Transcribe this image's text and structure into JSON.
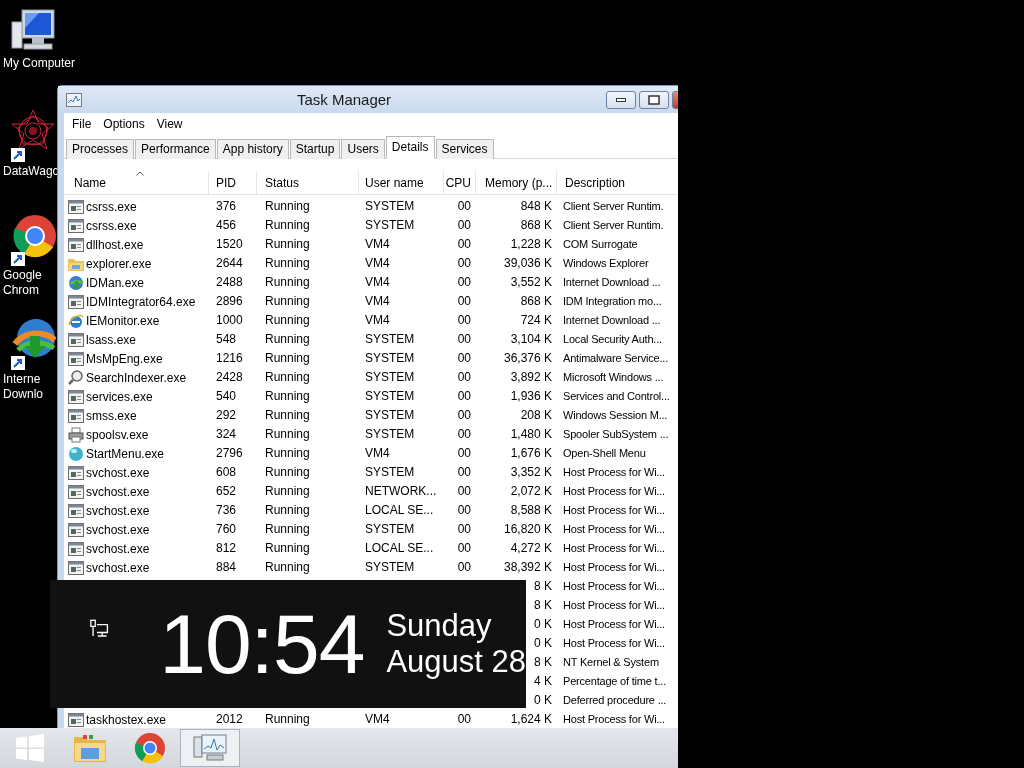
{
  "desktop_icons": [
    {
      "kind": "computer",
      "label": [
        "My Computer"
      ]
    },
    {
      "kind": "datawagon",
      "label": [
        "DataWagc"
      ]
    },
    {
      "kind": "chrome",
      "label": [
        "Google",
        "Chrom"
      ]
    },
    {
      "kind": "idm",
      "label": [
        "Interne",
        "Downlo"
      ]
    }
  ],
  "window": {
    "title": "Task Manager"
  },
  "menu": [
    "File",
    "Options",
    "View"
  ],
  "tabs": [
    {
      "label": "Processes",
      "selected": false
    },
    {
      "label": "Performance",
      "selected": false
    },
    {
      "label": "App history",
      "selected": false
    },
    {
      "label": "Startup",
      "selected": false
    },
    {
      "label": "Users",
      "selected": false
    },
    {
      "label": "Details",
      "selected": true
    },
    {
      "label": "Services",
      "selected": false
    }
  ],
  "table": {
    "columns": [
      {
        "label": "Name",
        "sorted": true
      },
      {
        "label": "PID",
        "sorted": false
      },
      {
        "label": "Status",
        "sorted": false
      },
      {
        "label": "User name",
        "sorted": false
      },
      {
        "label": "CPU",
        "sorted": false
      },
      {
        "label": "Memory (p...",
        "sorted": false
      },
      {
        "label": "Description",
        "sorted": false
      }
    ],
    "rows": [
      {
        "kind": "app",
        "name": "csrss.exe",
        "pid": "376",
        "status": "Running",
        "user": "SYSTEM",
        "cpu": "00",
        "memory": "848 K",
        "description": "Client Server Runtim."
      },
      {
        "kind": "app",
        "name": "csrss.exe",
        "pid": "456",
        "status": "Running",
        "user": "SYSTEM",
        "cpu": "00",
        "memory": "868 K",
        "description": "Client Server Runtim."
      },
      {
        "kind": "app",
        "name": "dllhost.exe",
        "pid": "1520",
        "status": "Running",
        "user": "VM4",
        "cpu": "00",
        "memory": "1,228 K",
        "description": "COM Surrogate"
      },
      {
        "kind": "folder",
        "name": "explorer.exe",
        "pid": "2644",
        "status": "Running",
        "user": "VM4",
        "cpu": "00",
        "memory": "39,036 K",
        "description": "Windows Explorer"
      },
      {
        "kind": "globe",
        "name": "IDMan.exe",
        "pid": "2488",
        "status": "Running",
        "user": "VM4",
        "cpu": "00",
        "memory": "3,552 K",
        "description": "Internet Download ..."
      },
      {
        "kind": "app",
        "name": "IDMIntegrator64.exe",
        "pid": "2896",
        "status": "Running",
        "user": "VM4",
        "cpu": "00",
        "memory": "868 K",
        "description": "IDM Integration mo..."
      },
      {
        "kind": "ie",
        "name": "IEMonitor.exe",
        "pid": "1000",
        "status": "Running",
        "user": "VM4",
        "cpu": "00",
        "memory": "724 K",
        "description": "Internet Download ..."
      },
      {
        "kind": "app",
        "name": "lsass.exe",
        "pid": "548",
        "status": "Running",
        "user": "SYSTEM",
        "cpu": "00",
        "memory": "3,104 K",
        "description": "Local Security Auth..."
      },
      {
        "kind": "app",
        "name": "MsMpEng.exe",
        "pid": "1216",
        "status": "Running",
        "user": "SYSTEM",
        "cpu": "00",
        "memory": "36,376 K",
        "description": "Antimalware Service..."
      },
      {
        "kind": "search",
        "name": "SearchIndexer.exe",
        "pid": "2428",
        "status": "Running",
        "user": "SYSTEM",
        "cpu": "00",
        "memory": "3,892 K",
        "description": "Microsoft Windows ..."
      },
      {
        "kind": "app",
        "name": "services.exe",
        "pid": "540",
        "status": "Running",
        "user": "SYSTEM",
        "cpu": "00",
        "memory": "1,936 K",
        "description": "Services and Control..."
      },
      {
        "kind": "app",
        "name": "smss.exe",
        "pid": "292",
        "status": "Running",
        "user": "SYSTEM",
        "cpu": "00",
        "memory": "208 K",
        "description": "Windows Session M..."
      },
      {
        "kind": "printer",
        "name": "spoolsv.exe",
        "pid": "324",
        "status": "Running",
        "user": "SYSTEM",
        "cpu": "00",
        "memory": "1,480 K",
        "description": "Spooler SubSystem ..."
      },
      {
        "kind": "sphere",
        "name": "StartMenu.exe",
        "pid": "2796",
        "status": "Running",
        "user": "VM4",
        "cpu": "00",
        "memory": "1,676 K",
        "description": "Open-Shell Menu"
      },
      {
        "kind": "app",
        "name": "svchost.exe",
        "pid": "608",
        "status": "Running",
        "user": "SYSTEM",
        "cpu": "00",
        "memory": "3,352 K",
        "description": "Host Process for Wi..."
      },
      {
        "kind": "app",
        "name": "svchost.exe",
        "pid": "652",
        "status": "Running",
        "user": "NETWORK...",
        "cpu": "00",
        "memory": "2,072 K",
        "description": "Host Process for Wi..."
      },
      {
        "kind": "app",
        "name": "svchost.exe",
        "pid": "736",
        "status": "Running",
        "user": "LOCAL SE...",
        "cpu": "00",
        "memory": "8,588 K",
        "description": "Host Process for Wi..."
      },
      {
        "kind": "app",
        "name": "svchost.exe",
        "pid": "760",
        "status": "Running",
        "user": "SYSTEM",
        "cpu": "00",
        "memory": "16,820 K",
        "description": "Host Process for Wi..."
      },
      {
        "kind": "app",
        "name": "svchost.exe",
        "pid": "812",
        "status": "Running",
        "user": "LOCAL SE...",
        "cpu": "00",
        "memory": "4,272 K",
        "description": "Host Process for Wi..."
      },
      {
        "kind": "app",
        "name": "svchost.exe",
        "pid": "884",
        "status": "Running",
        "user": "SYSTEM",
        "cpu": "00",
        "memory": "38,392 K",
        "description": "Host Process for Wi..."
      },
      {
        "memory": "8 K",
        "description": "Host Process for Wi..."
      },
      {
        "memory": "8 K",
        "description": "Host Process for Wi..."
      },
      {
        "memory": "0 K",
        "description": "Host Process for Wi..."
      },
      {
        "memory": "0 K",
        "description": "Host Process for Wi..."
      },
      {
        "memory": "8 K",
        "description": "NT Kernel & System"
      },
      {
        "memory": "4 K",
        "description": "Percentage of time t..."
      },
      {
        "memory": "0 K",
        "description": "Deferred procedure ..."
      },
      {
        "kind": "app",
        "name": "taskhostex.exe",
        "pid": "2012",
        "status": "Running",
        "user": "VM4",
        "cpu": "00",
        "memory": "1,624 K",
        "description": "Host Process for Wi..."
      }
    ]
  },
  "clock": {
    "time": "10:54",
    "day": "Sunday",
    "date": "August 28"
  },
  "taskbar": {
    "items": [
      {
        "kind": "start",
        "active": false
      },
      {
        "kind": "explorer",
        "active": false
      },
      {
        "kind": "chrome",
        "active": false
      },
      {
        "kind": "taskmgr",
        "active": true
      }
    ]
  }
}
